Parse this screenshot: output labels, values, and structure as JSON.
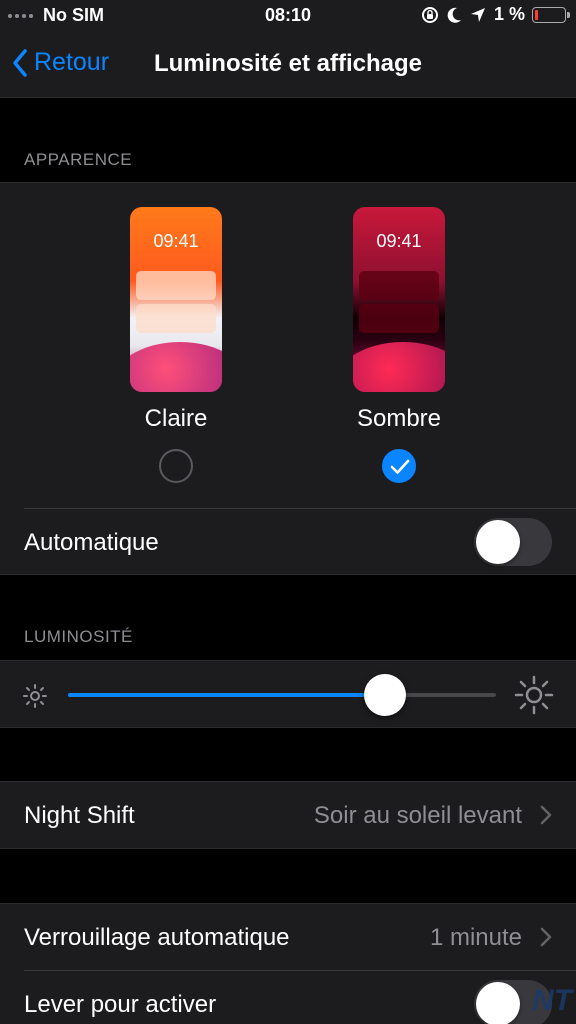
{
  "status_bar": {
    "carrier": "No SIM",
    "time": "08:10",
    "battery_percent": "1 %",
    "battery_level": 0.01
  },
  "nav": {
    "back_label": "Retour",
    "title": "Luminosité et affichage"
  },
  "appearance": {
    "header": "APPARENCE",
    "light": {
      "label": "Claire",
      "preview_time": "09:41",
      "selected": false
    },
    "dark": {
      "label": "Sombre",
      "preview_time": "09:41",
      "selected": true
    },
    "automatic_label": "Automatique",
    "automatic_on": false
  },
  "brightness": {
    "header": "LUMINOSITÉ",
    "level": 0.74
  },
  "night_shift": {
    "label": "Night Shift",
    "value": "Soir au soleil levant"
  },
  "lock": {
    "auto_lock_label": "Verrouillage automatique",
    "auto_lock_value": "1 minute",
    "raise_to_wake_label": "Lever pour activer",
    "raise_to_wake_on": false
  },
  "watermark": "NT",
  "colors": {
    "accent": "#0a84ff",
    "background": "#000000",
    "cell": "#1c1c1e",
    "secondary_text": "#8e8e93"
  }
}
